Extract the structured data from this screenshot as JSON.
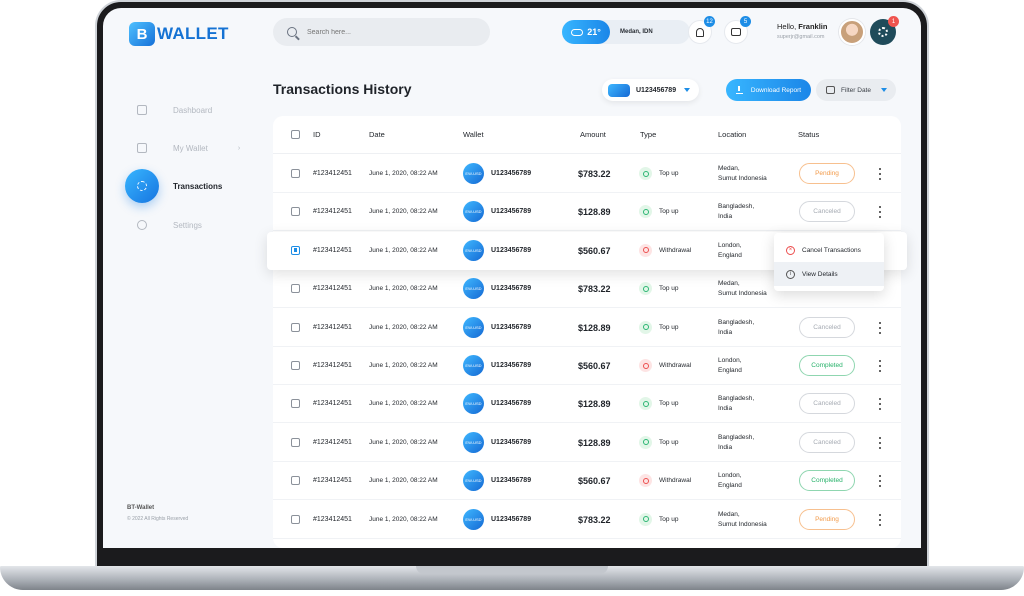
{
  "app": {
    "logo_mark": "B",
    "logo_text": "WALLET"
  },
  "search": {
    "placeholder": "Search here..."
  },
  "weather": {
    "temp": "21°",
    "location": "Medan, IDN"
  },
  "notifications": {
    "bell_count": "12",
    "chat_count": "5",
    "settings_count": "1"
  },
  "user": {
    "greeting": "Hello,",
    "name": "Franklin",
    "email": "superjr@gmail.com"
  },
  "sidebar": {
    "items": [
      {
        "label": "Dashboard",
        "icon": "dashboard-icon"
      },
      {
        "label": "My Wallet",
        "icon": "wallet-icon"
      },
      {
        "label": "Transactions",
        "icon": "transactions-icon",
        "active": true
      },
      {
        "label": "Settings",
        "icon": "settings-icon"
      }
    ],
    "footer_brand": "BT-Wallet",
    "footer_copy": "© 2022 All Rights Reserved"
  },
  "page": {
    "title": "Transactions History",
    "account": "U123456789",
    "download_label": "Download Report",
    "filter_label": "Filter Date"
  },
  "table": {
    "headers": {
      "id": "ID",
      "date": "Date",
      "wallet": "Wallet",
      "amount": "Amount",
      "type": "Type",
      "location": "Location",
      "status": "Status"
    },
    "wallet_chip": "EW-USD",
    "rows": [
      {
        "id": "#123412451",
        "date": "June 1, 2020, 08:22 AM",
        "wallet": "U123456789",
        "amount": "$783.22",
        "type": "Top up",
        "loc1": "Medan,",
        "loc2": "Sumut Indonesia",
        "status": "Pending"
      },
      {
        "id": "#123412451",
        "date": "June 1, 2020, 08:22 AM",
        "wallet": "U123456789",
        "amount": "$128.89",
        "type": "Top up",
        "loc1": "Bangladesh,",
        "loc2": "India",
        "status": "Canceled"
      },
      {
        "id": "#123412451",
        "date": "June 1, 2020, 08:22 AM",
        "wallet": "U123456789",
        "amount": "$560.67",
        "type": "Withdrawal",
        "loc1": "London,",
        "loc2": "England",
        "status": ""
      },
      {
        "id": "#123412451",
        "date": "June 1, 2020, 08:22 AM",
        "wallet": "U123456789",
        "amount": "$783.22",
        "type": "Top up",
        "loc1": "Medan,",
        "loc2": "Sumut Indonesia",
        "status": ""
      },
      {
        "id": "#123412451",
        "date": "June 1, 2020, 08:22 AM",
        "wallet": "U123456789",
        "amount": "$128.89",
        "type": "Top up",
        "loc1": "Bangladesh,",
        "loc2": "India",
        "status": "Canceled"
      },
      {
        "id": "#123412451",
        "date": "June 1, 2020, 08:22 AM",
        "wallet": "U123456789",
        "amount": "$560.67",
        "type": "Withdrawal",
        "loc1": "London,",
        "loc2": "England",
        "status": "Completed"
      },
      {
        "id": "#123412451",
        "date": "June 1, 2020, 08:22 AM",
        "wallet": "U123456789",
        "amount": "$128.89",
        "type": "Top up",
        "loc1": "Bangladesh,",
        "loc2": "India",
        "status": "Canceled"
      },
      {
        "id": "#123412451",
        "date": "June 1, 2020, 08:22 AM",
        "wallet": "U123456789",
        "amount": "$128.89",
        "type": "Top up",
        "loc1": "Bangladesh,",
        "loc2": "India",
        "status": "Canceled"
      },
      {
        "id": "#123412451",
        "date": "June 1, 2020, 08:22 AM",
        "wallet": "U123456789",
        "amount": "$560.67",
        "type": "Withdrawal",
        "loc1": "London,",
        "loc2": "England",
        "status": "Completed"
      },
      {
        "id": "#123412451",
        "date": "June 1, 2020, 08:22 AM",
        "wallet": "U123456789",
        "amount": "$783.22",
        "type": "Top up",
        "loc1": "Medan,",
        "loc2": "Sumut Indonesia",
        "status": "Pending"
      }
    ]
  },
  "popup": {
    "cancel_label": "Cancel Transactions",
    "details_label": "View Details"
  },
  "colors": {
    "accent": "#1d8de6",
    "pending": "#f29b4b",
    "completed": "#27b26a",
    "canceled": "#a6abb3",
    "withdraw": "#ec4f4f"
  }
}
